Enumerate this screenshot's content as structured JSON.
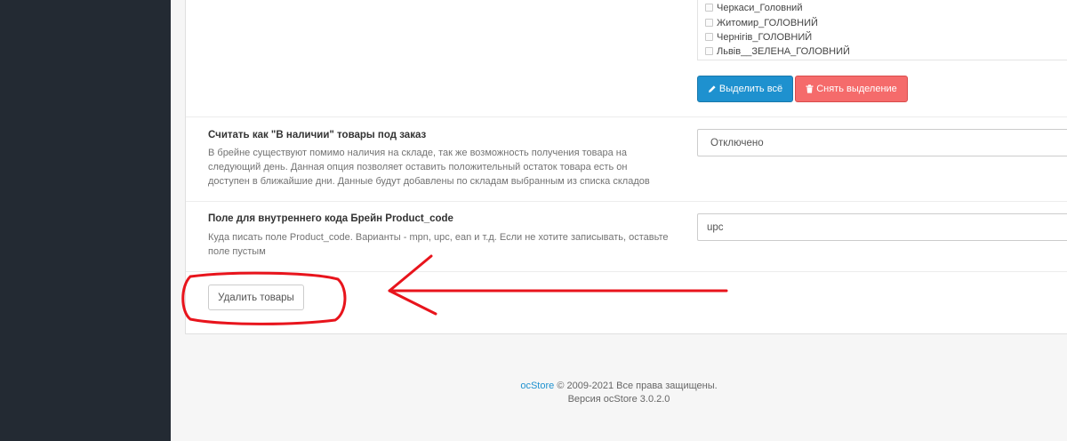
{
  "stores": {
    "items": [
      {
        "label": "Черкаси_Головний",
        "checked": false
      },
      {
        "label": "Житомир_ГОЛОВНИЙ",
        "checked": false
      },
      {
        "label": "Чернігів_ГОЛОВНИЙ",
        "checked": false
      },
      {
        "label": "Львів__ЗЕЛЕНА_ГОЛОВНИЙ",
        "checked": false
      }
    ],
    "select_all_label": "Выделить всё",
    "deselect_label": "Снять выделение"
  },
  "settings": {
    "in_stock_order": {
      "title": "Считать как \"В наличии\" товары под заказ",
      "help": "В брейне существуют помимо наличия на складе, так же возможность получения товара на следующий день. Данная опция позволяет оставить положительный остаток товара есть он доступен в ближайшие дни. Данные будут добавлены по складам выбранным из списка складов",
      "value": "Отключено"
    },
    "product_code": {
      "title": "Поле для внутреннего кода Брейн Product_code",
      "help": "Куда писать поле Product_code. Варианты - mpn, upc, ean и т.д. Если не хотите записывать, оставьте поле пустым",
      "value": "upc"
    }
  },
  "delete_button_label": "Удалить товары",
  "footer": {
    "brand": "ocStore",
    "copyright": "© 2009-2021 Все права защищены.",
    "version": "Версия ocStore 3.0.2.0"
  },
  "colors": {
    "sidebar": "#232a33",
    "primary": "#1e91cf",
    "danger": "#f56b6b",
    "annotation": "#e8141c"
  }
}
